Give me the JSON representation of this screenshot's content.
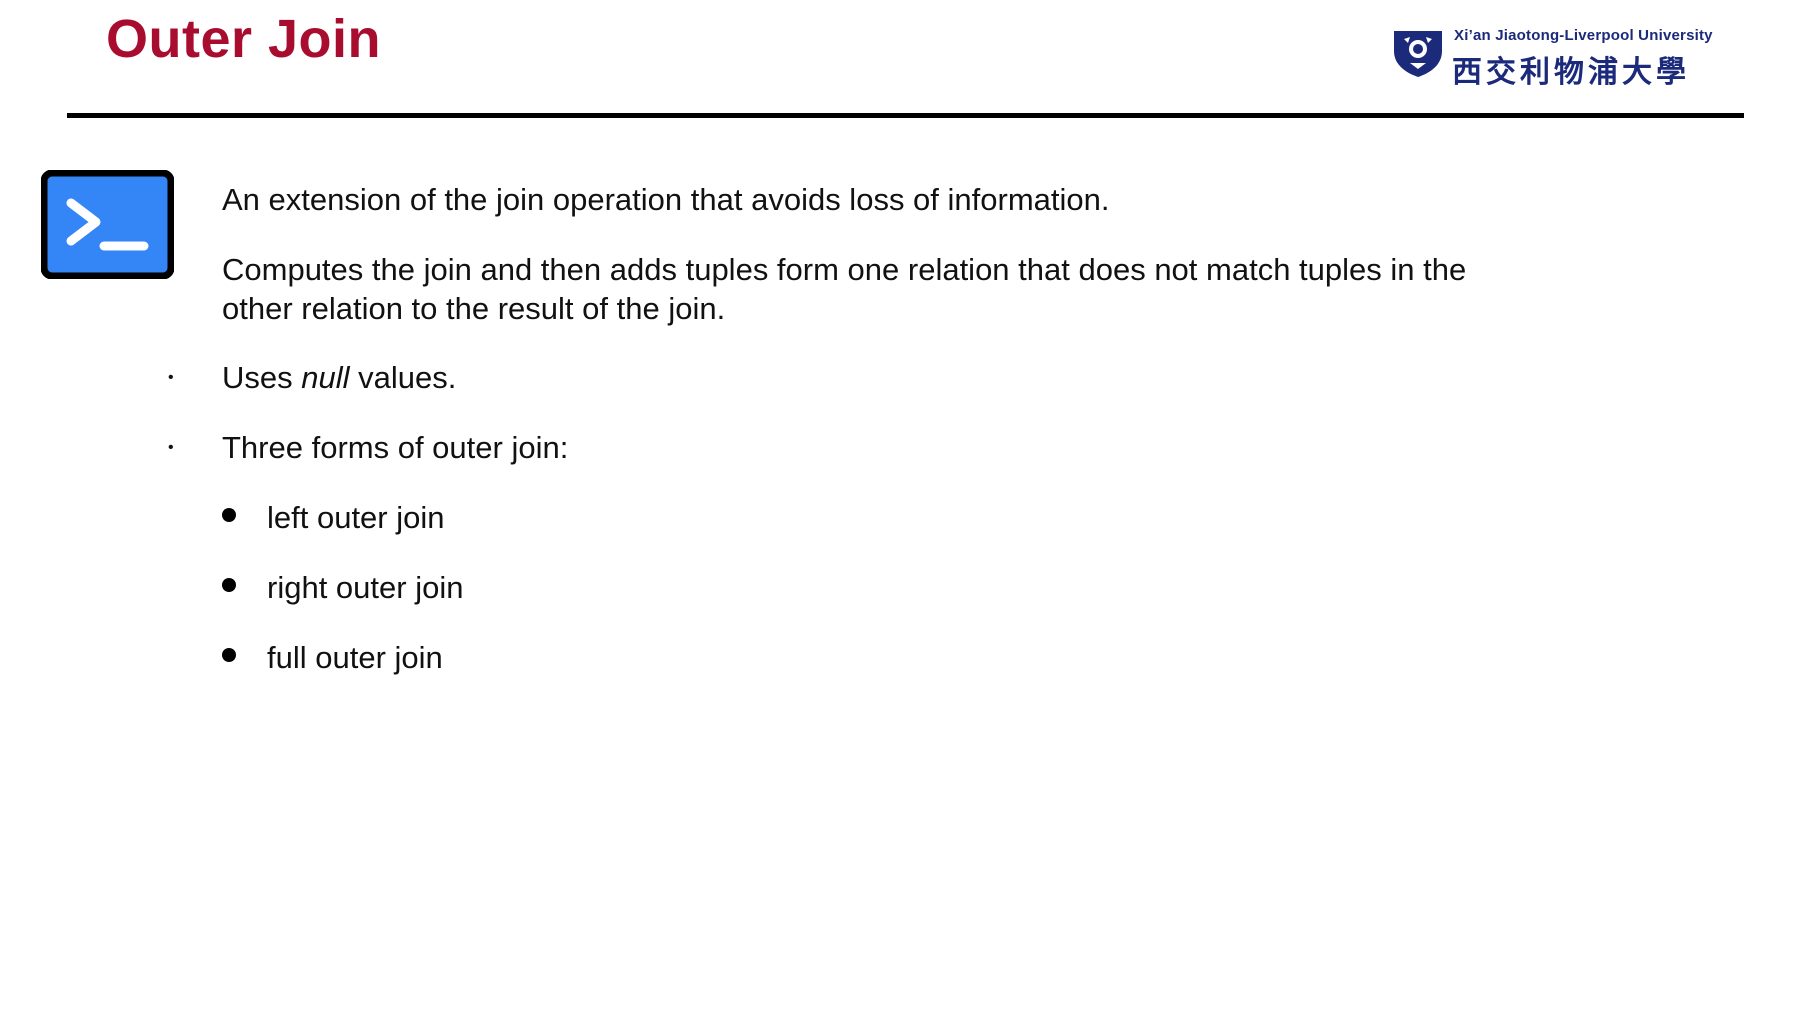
{
  "slide": {
    "title": "Outer Join"
  },
  "logo": {
    "english_name": "Xi’an Jiaotong-Liverpool University",
    "chinese_name": "西交利物浦大學"
  },
  "content": {
    "paragraph1": "An extension of the join operation that avoids loss of information.",
    "paragraph2": "Computes the join and then adds tuples form one relation that does not match tuples in the other relation to the result of the join.",
    "bullet1": {
      "prefix": "Uses ",
      "emphasis": "null",
      "suffix": " values."
    },
    "bullet2": "Three forms of outer join:",
    "sub_bullets": [
      "left outer join",
      "right outer join",
      "full outer join"
    ]
  },
  "icons": {
    "terminal": "terminal-icon",
    "shield": "university-shield-icon"
  },
  "colors": {
    "title": "#a80c2e",
    "terminal_blue": "#3485f5",
    "logo_navy": "#1b2a7a"
  }
}
